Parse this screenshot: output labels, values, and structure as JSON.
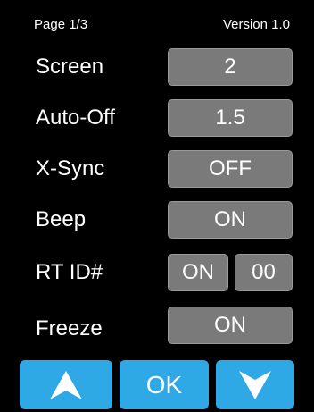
{
  "header": {
    "page": "Page 1/3",
    "version": "Version 1.0"
  },
  "settings": [
    {
      "label": "Screen",
      "value": "2"
    },
    {
      "label": "Auto-Off",
      "value": "1.5"
    },
    {
      "label": "X-Sync",
      "value": "OFF"
    },
    {
      "label": "Beep",
      "value": "ON"
    },
    {
      "label": "RT ID#",
      "value": "ON",
      "value2": "00"
    },
    {
      "label": "Freeze",
      "value": "ON"
    }
  ],
  "nav": {
    "up_icon": "up-arrow-icon",
    "ok_label": "OK",
    "down_icon": "down-arrow-icon"
  },
  "colors": {
    "background": "#000000",
    "value_button": "#7a7a7a",
    "nav_button": "#2ea9e6",
    "text": "#ffffff"
  }
}
